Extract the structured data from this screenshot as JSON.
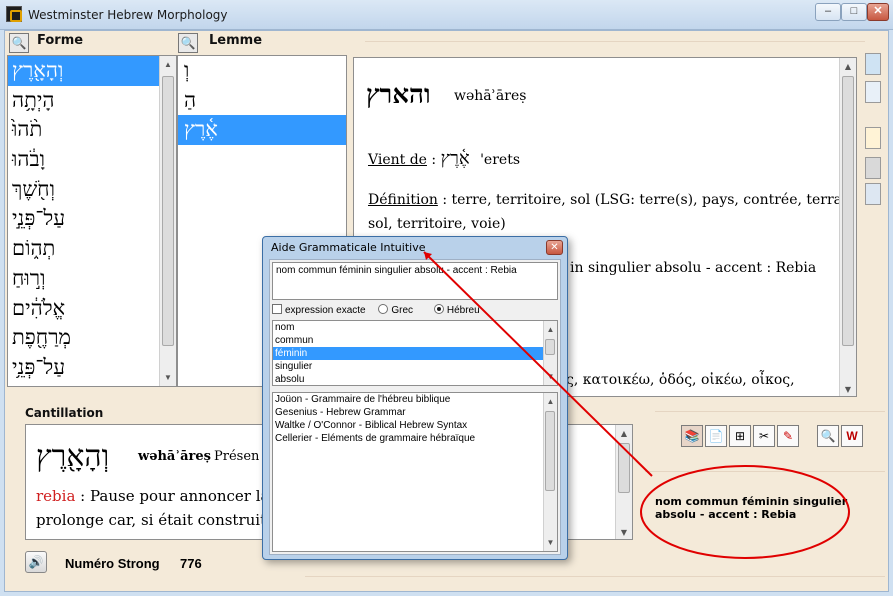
{
  "window": {
    "title": "Westminster Hebrew Morphology",
    "minimize": "–",
    "maximize": "□",
    "close": "✕"
  },
  "forme": {
    "header": "Forme",
    "items": [
      "וְהָאָ֖רֶץ",
      "הָיְתָ֥ה",
      "תֹ֨הוּ֙",
      "וָבֹ֔הוּ",
      "וְחֹ֖שֶׁךְ",
      "עַל־פְּנֵ֣י",
      "תְה֑וֹם",
      "וְר֣וּחַ",
      "אֱלֹהִ֔ים",
      "מְרַחֶ֖פֶת",
      "עַל־פְּנֵ֥י"
    ],
    "selected_index": 0
  },
  "lemme": {
    "header": "Lemme",
    "items": [
      "וְ",
      "הַ",
      "אֶ֫רֶץ"
    ],
    "selected_index": 2
  },
  "detail": {
    "word_hebrew": "והארץ",
    "word_translit": "wəhāʾāreṣ",
    "vient_de_label": "Vient de",
    "vient_de_sep": " : ",
    "vient_de_hebrew": "אֶ֫רֶץ",
    "vient_de_translit": "'erets",
    "definition_label": "Définition",
    "definition_line1": " : terre, territoire, sol (LSG: terre(s), pays, contrée, terrain,",
    "definition_line2": "sol, territoire, voie)",
    "morph_visible": "in singulier absolu - accent : Rebia",
    "greek_visible": "ς, κατοικέω, ὁδός, οἰκέω, οἶκος,"
  },
  "cantillation": {
    "header": "Cantillation",
    "word_hebrew": "וְהָאָ֖רֶץ",
    "word_translit": "wəhāʾāreṣ",
    "word_rest": "Présen",
    "accent_name": "rebia",
    "accent_desc": " : Pause pour annoncer la",
    "line2": "prolonge car, si était construit,",
    "accent_color": "#d02020"
  },
  "strong": {
    "label": "Numéro Strong",
    "number": "776"
  },
  "callout": {
    "text": "nom commun féminin singulier absolu - accent : Rebia",
    "color": "#e00000"
  },
  "dialog": {
    "title": "Aide Grammaticale Intuitive",
    "close": "✕",
    "text": "nom commun féminin singulier absolu - accent : Rebia",
    "option_exact": "expression exacte",
    "option_grec": "Grec",
    "option_hebreu": "Hébreu",
    "terms": [
      "nom",
      "commun",
      "féminin",
      "singulier",
      "absolu"
    ],
    "selected_term": 2,
    "references": [
      "Joüon - Grammaire de l'hébreu biblique",
      "Gesenius - Hebrew Grammar",
      "Waltke / O'Connor - Biblical Hebrew Syntax",
      "Cellerier - Eléments de grammaire hébraïque"
    ]
  },
  "icons": {
    "search": "search-icon",
    "books": "books-icon",
    "document": "document-icon",
    "tree": "tree-icon",
    "tools": "tools-icon",
    "pdf": "pdf-icon",
    "zoom": "zoom-icon",
    "logo": "logo-icon",
    "speaker": "speaker-icon"
  }
}
